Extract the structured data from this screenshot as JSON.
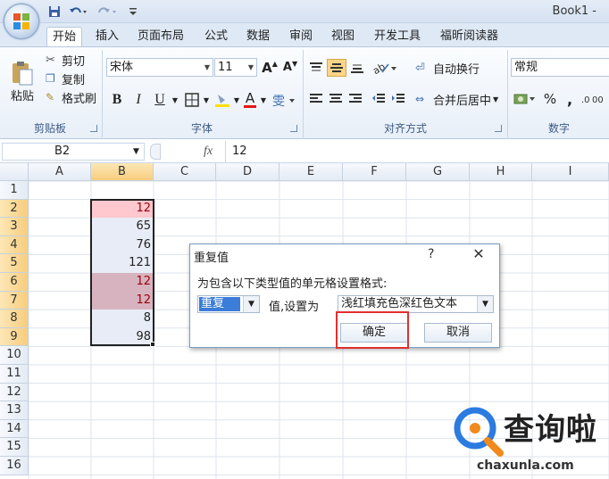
{
  "window": {
    "title": "Book1 -"
  },
  "tabs": [
    "开始",
    "插入",
    "页面布局",
    "公式",
    "数据",
    "审阅",
    "视图",
    "开发工具",
    "福昕阅读器"
  ],
  "ribbon": {
    "clipboard": {
      "paste": "粘贴",
      "cut": "剪切",
      "copy": "复制",
      "format_painter": "格式刷",
      "label": "剪贴板"
    },
    "font": {
      "name": "宋体",
      "size": "11",
      "bold": "B",
      "italic": "I",
      "underline": "U",
      "font_color_glyph": "A",
      "label": "字体"
    },
    "alignment": {
      "wrap_text": "自动换行",
      "merge_center": "合并后居中",
      "label": "对齐方式"
    },
    "number": {
      "format": "常规",
      "percent": "%",
      "comma": ",",
      "label": "数字"
    }
  },
  "formula_bar": {
    "name_box": "B2",
    "fx": "fx",
    "value": "12"
  },
  "columns": [
    "A",
    "B",
    "C",
    "D",
    "E",
    "F",
    "G",
    "H",
    "I"
  ],
  "rows": [
    "1",
    "2",
    "3",
    "4",
    "5",
    "6",
    "7",
    "8",
    "9",
    "10",
    "11",
    "12",
    "13",
    "14",
    "15",
    "16"
  ],
  "cells_b": [
    "",
    "12",
    "65",
    "76",
    "121",
    "12",
    "12",
    "8",
    "98"
  ],
  "dialog": {
    "title": "重复值",
    "help": "?",
    "instruction": "为包含以下类型值的单元格设置格式:",
    "type_value": "重复",
    "mid_label": "值,设置为",
    "format_value": "浅红填充色深红色文本",
    "ok": "确定",
    "cancel": "取消"
  },
  "watermark": {
    "brand": "查询啦",
    "domain": "chaxunla.com"
  },
  "colors": {
    "accent": "#2b5797",
    "dup_fill": "#ffc7ce",
    "dup_text": "#9c0006",
    "highlight_box": "#e0302f"
  }
}
